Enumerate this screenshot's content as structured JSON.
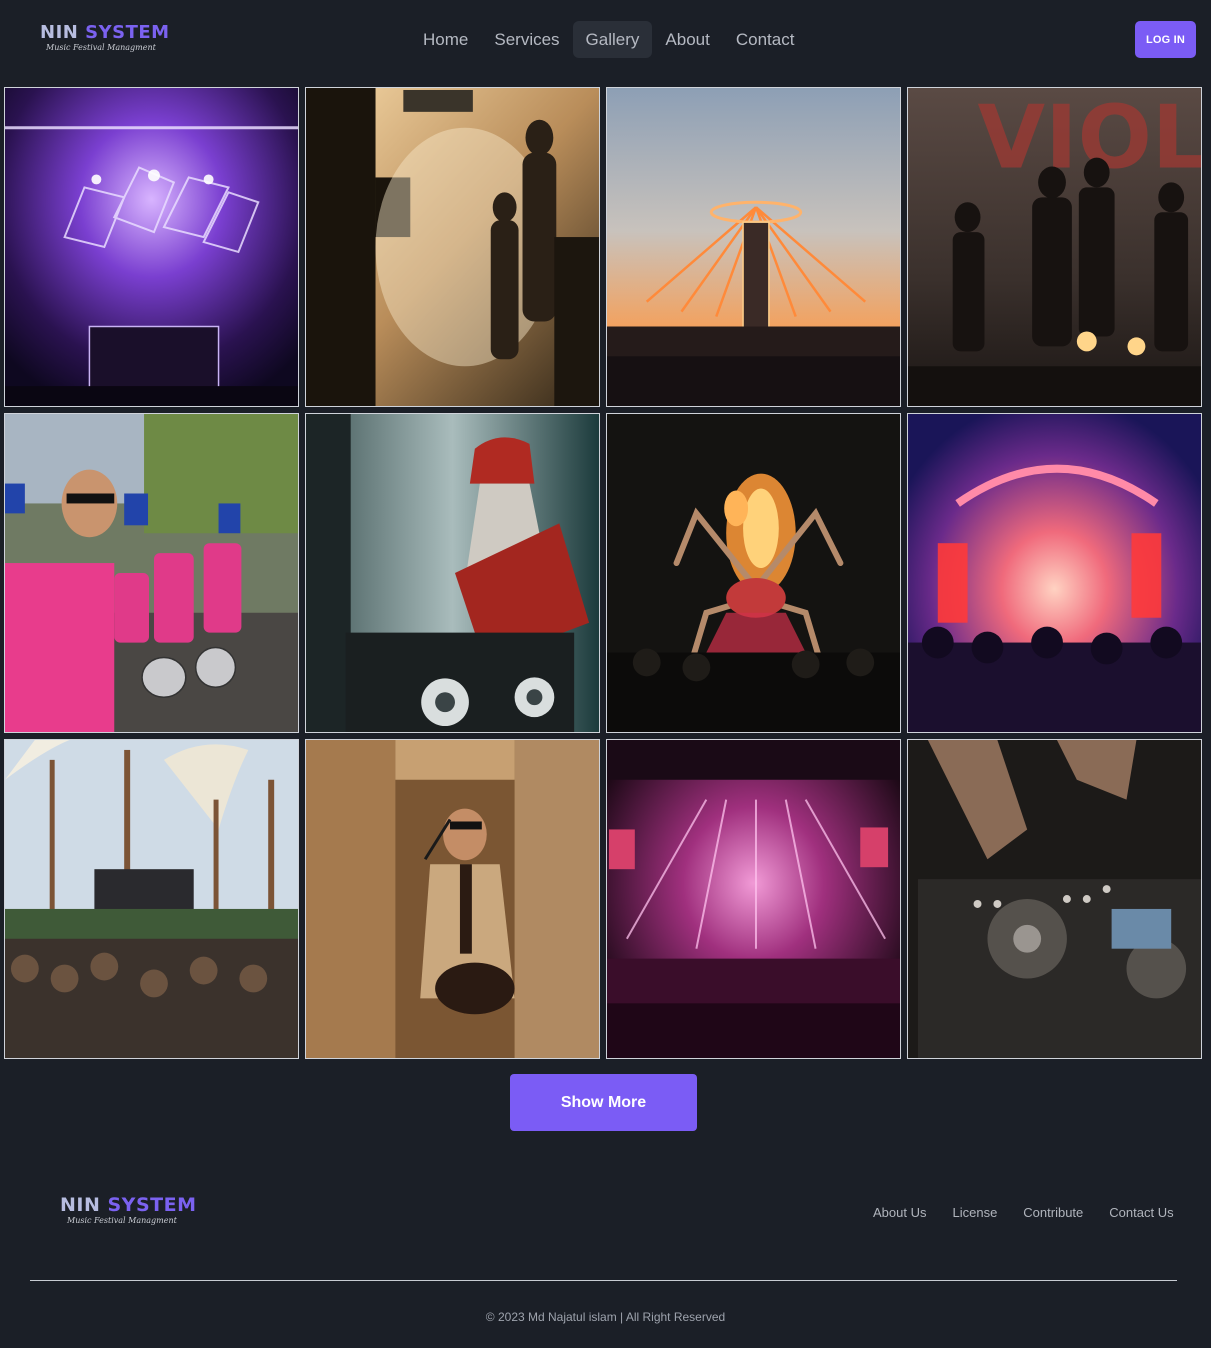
{
  "brand": {
    "name_part1": "NIN",
    "name_part2": "SYSTEM",
    "tagline": "Music Festival Managment"
  },
  "nav": {
    "items": [
      {
        "label": "Home"
      },
      {
        "label": "Services"
      },
      {
        "label": "Gallery",
        "active": true
      },
      {
        "label": "About"
      },
      {
        "label": "Contact"
      }
    ]
  },
  "auth": {
    "login_label": "LOG IN"
  },
  "gallery": {
    "images": [
      {
        "subject": "dj-stage-purple-lights"
      },
      {
        "subject": "crowd-in-dusty-sunlight"
      },
      {
        "subject": "fairground-swing-ride-sunset"
      },
      {
        "subject": "band-on-stage"
      },
      {
        "subject": "street-drummers-parade"
      },
      {
        "subject": "dj-in-red-hat"
      },
      {
        "subject": "fire-spider-sculpture"
      },
      {
        "subject": "concert-stage-crowd-pink"
      },
      {
        "subject": "outdoor-festival-crowd"
      },
      {
        "subject": "singer-with-guitar"
      },
      {
        "subject": "laser-light-show"
      },
      {
        "subject": "dj-mixer-hands"
      }
    ]
  },
  "actions": {
    "show_more_label": "Show More"
  },
  "footer": {
    "links": [
      "About Us",
      "License",
      "Contribute",
      "Contact Us"
    ],
    "copyright": "© 2023 Md Najatul islam | All Right Reserved"
  },
  "colors": {
    "background": "#1b1f27",
    "accent": "#7b5cf5",
    "logo_nin": "#b7bde0",
    "logo_system": "#7b62f0"
  }
}
